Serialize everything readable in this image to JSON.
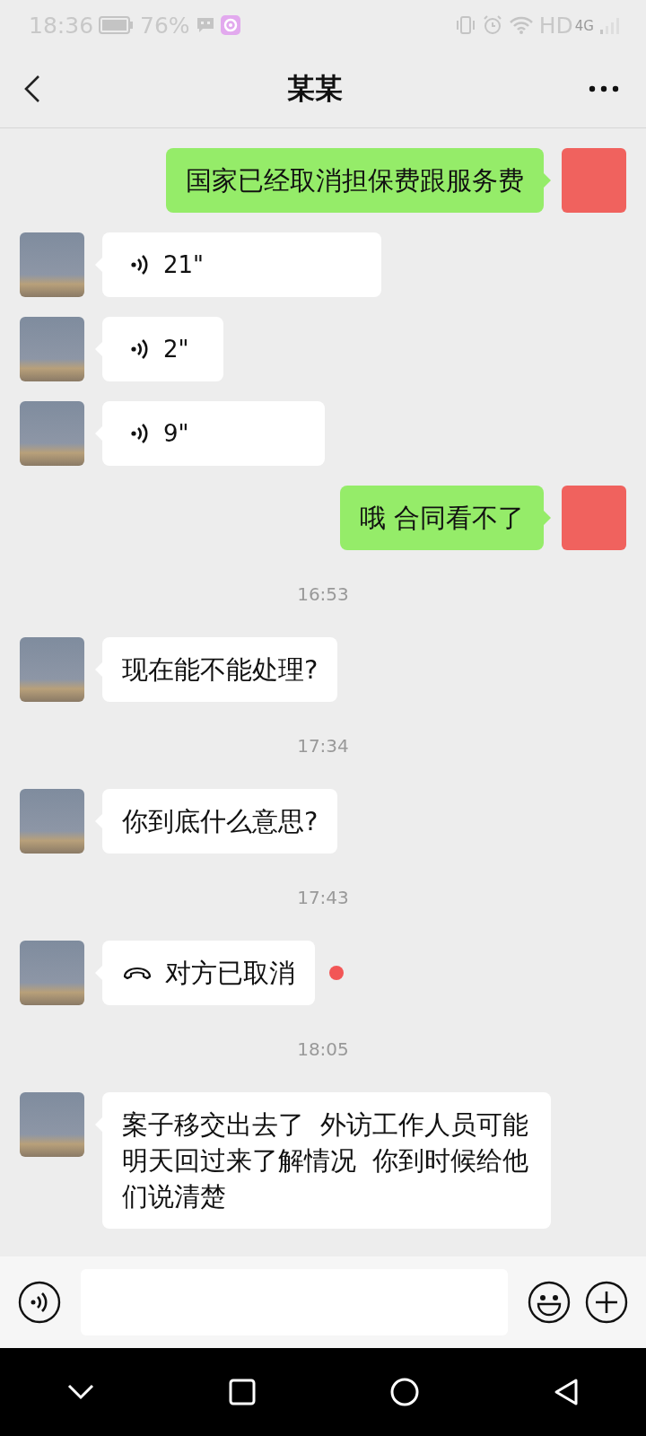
{
  "status_bar": {
    "time": "18:36",
    "battery": "76%",
    "network": "HD",
    "network_type": "4G"
  },
  "header": {
    "title": "某某"
  },
  "messages": [
    {
      "kind": "text",
      "outgoing": true,
      "text": "国家已经取消担保费跟服务费"
    },
    {
      "kind": "voice",
      "outgoing": false,
      "duration": "21\""
    },
    {
      "kind": "voice",
      "outgoing": false,
      "duration": "2\""
    },
    {
      "kind": "voice",
      "outgoing": false,
      "duration": "9\""
    },
    {
      "kind": "text",
      "outgoing": true,
      "text": "哦 合同看不了"
    },
    {
      "kind": "time",
      "text": "16:53"
    },
    {
      "kind": "text",
      "outgoing": false,
      "text": "现在能不能处理?"
    },
    {
      "kind": "time",
      "text": "17:34"
    },
    {
      "kind": "text",
      "outgoing": false,
      "text": "你到底什么意思?"
    },
    {
      "kind": "time",
      "text": "17:43"
    },
    {
      "kind": "call",
      "outgoing": false,
      "text": "对方已取消",
      "unread": true
    },
    {
      "kind": "time",
      "text": "18:05"
    },
    {
      "kind": "text",
      "outgoing": false,
      "text": "案子移交出去了  外访工作人员可能明天回过来了解情况  你到时候给他们说清楚"
    }
  ]
}
